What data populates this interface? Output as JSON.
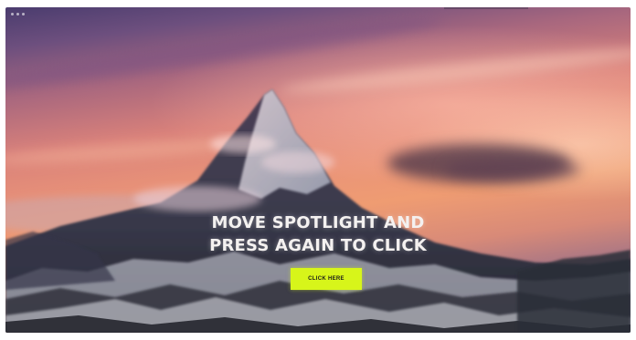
{
  "hero": {
    "headline_line1": "MOVE SPOTLIGHT AND",
    "headline_line2": "PRESS AGAIN TO CLICK",
    "cta_label": "CLICK HERE"
  },
  "colors": {
    "cta_background": "#d7f51a",
    "headline_text": "#f4f1f0",
    "sky_top": "#4a3c6e",
    "sky_glow": "#ef9c72"
  },
  "icons": {
    "window_controls": "window-dots-icon"
  }
}
